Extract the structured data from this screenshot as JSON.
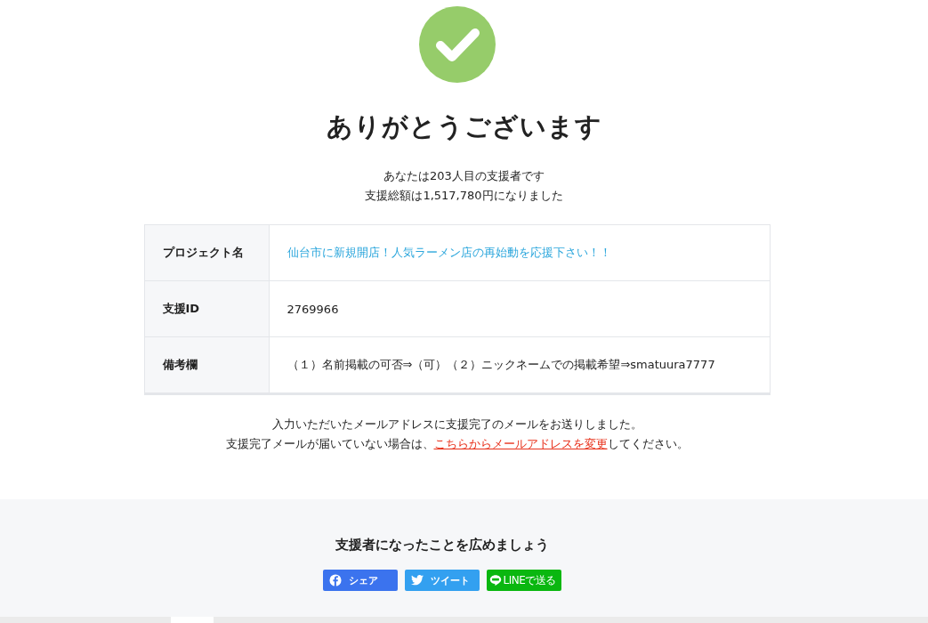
{
  "title": "ありがとうございます",
  "summary": [
    "あなたは203人目の支援者です",
    "支援総額は1,517,780円になりました"
  ],
  "details": [
    {
      "label": "プロジェクト名",
      "value": "仙台市に新規開店！人気ラーメン店の再始動を応援下さい！！",
      "kind": "link"
    },
    {
      "label": "支援ID",
      "value": "2769966",
      "kind": "text"
    },
    {
      "label": "備考欄",
      "value": "（１）名前掲載の可否⇒（可）（２）ニックネームでの掲載希望⇒smatuura7777",
      "kind": "text"
    }
  ],
  "notice": {
    "line_1": "入力いただいたメールアドレスに支援完了のメールをお送りしました。",
    "line_2_before": "支援完了メールが届いていない場合は、",
    "link": "こちらからメールアドレスを変更",
    "line_2_after": "してください。"
  },
  "share": {
    "heading": "支援者になったことを広めましょう",
    "buttons": [
      {
        "label": "シェア",
        "kind": "facebook"
      },
      {
        "label": "ツイート",
        "kind": "twitter"
      },
      {
        "label": "LINEで送る",
        "kind": "line"
      }
    ]
  }
}
